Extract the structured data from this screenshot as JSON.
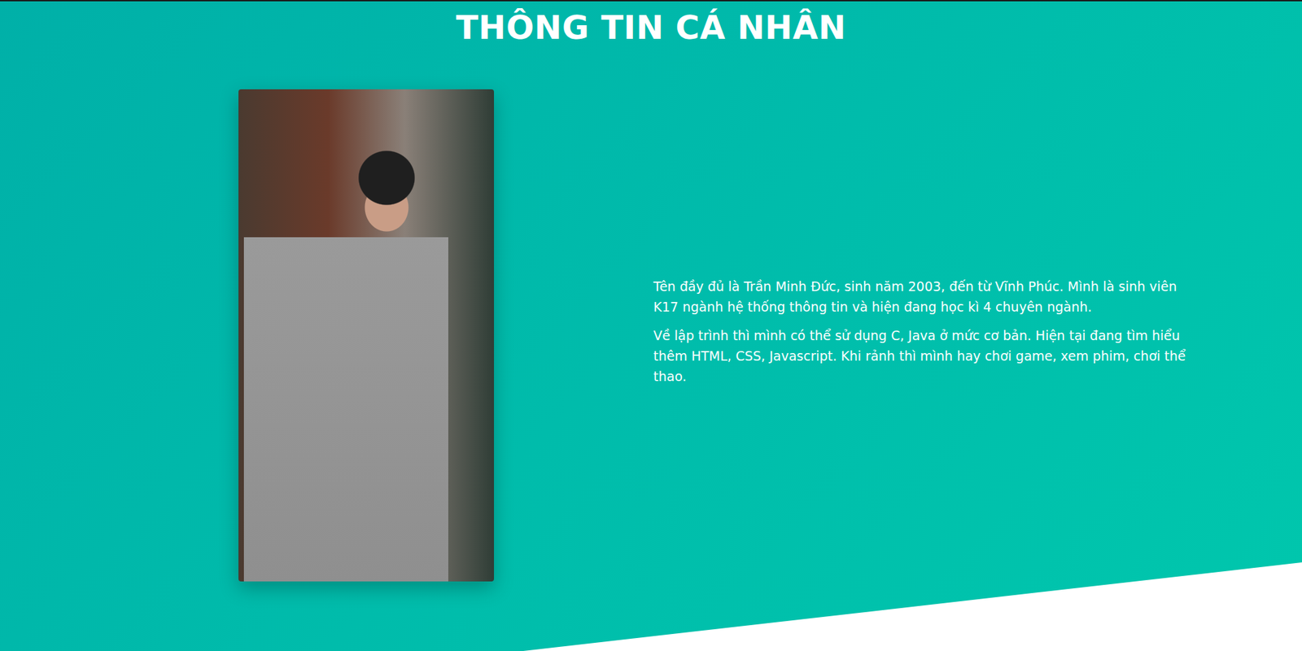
{
  "section": {
    "title": "THÔNG TIN CÁ NHÂN"
  },
  "paragraphs": [
    "Tên đầy đủ là Trần Minh Đức, sinh năm 2003, đến từ Vĩnh Phúc. Mình là sinh viên K17 ngành hệ thống thông tin và hiện đang học kì 4 chuyên ngành.",
    "Về lập trình thì mình có thể sử dụng C, Java ở mức cơ bản. Hiện tại đang tìm hiểu thêm HTML, CSS, Javascript. Khi rảnh thì mình hay chơi game, xem phim, chơi thể thao."
  ]
}
